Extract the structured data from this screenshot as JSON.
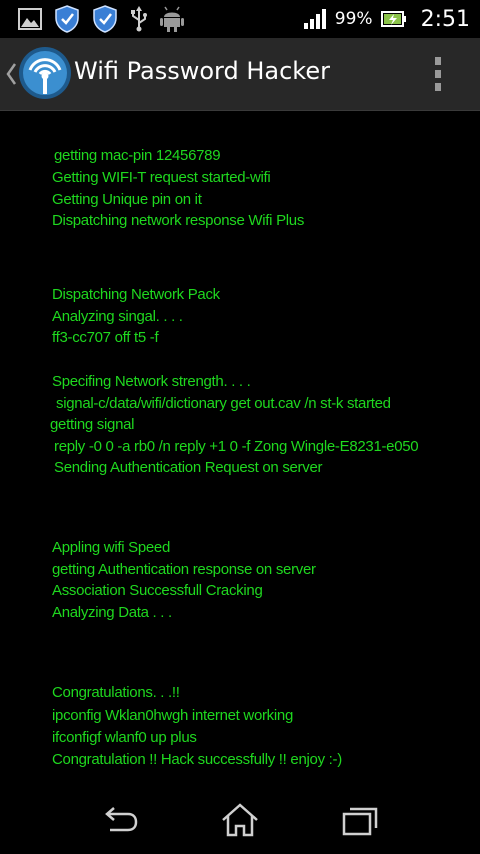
{
  "status_bar": {
    "battery_percent": "99%",
    "time": "2:51"
  },
  "action_bar": {
    "title": "Wifi Password Hacker"
  },
  "console": {
    "lines": [
      "getting mac-pin 12456789",
      "Getting WIFI-T request started-wifi",
      "Getting Unique pin on it",
      "Dispatching network response Wifi Plus",
      "Dispatching Network Pack",
      "Analyzing singal. . . .",
      "ff3-cc707 off t5 -f",
      "Specifing Network strength. . . .",
      "signal-c/data/wifi/dictionary get out.cav /n st-k started",
      "getting signal",
      "reply -0 0 -a rb0 /n reply +1 0 -f Zong Wingle-E8231-e050",
      "Sending Authentication Request on server",
      "Appling wifi Speed",
      "getting Authentication response on server",
      "Association Successfull Cracking",
      "Analyzing Data . . .",
      "Congratulations. . .!!",
      "ipconfig Wklan0hwgh internet working",
      "ifconfigf wlanf0 up plus",
      "Congratulation !! Hack successfully !! enjoy :-)"
    ]
  },
  "colors": {
    "console_text": "#1fd81f",
    "action_bar_bg": "#282828",
    "shield_blue": "#3a7fd5",
    "android_green": "#9a9a9a"
  }
}
